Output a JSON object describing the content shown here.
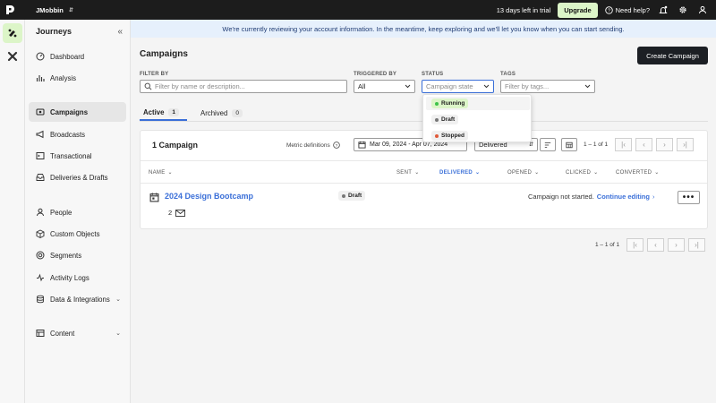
{
  "topbar": {
    "workspace": "JMobbin",
    "trial": "13 days left in trial",
    "upgrade": "Upgrade",
    "help": "Need help?"
  },
  "sidebar": {
    "title": "Journeys",
    "items": [
      {
        "label": "Dashboard",
        "icon": "dashboard-icon"
      },
      {
        "label": "Analysis",
        "icon": "bar-chart-icon"
      },
      {
        "label": "Campaigns",
        "icon": "campaign-icon",
        "active": true
      },
      {
        "label": "Broadcasts",
        "icon": "megaphone-icon"
      },
      {
        "label": "Transactional",
        "icon": "terminal-icon"
      },
      {
        "label": "Deliveries & Drafts",
        "icon": "inbox-icon"
      },
      {
        "label": "People",
        "icon": "person-icon"
      },
      {
        "label": "Custom Objects",
        "icon": "cube-icon"
      },
      {
        "label": "Segments",
        "icon": "segments-icon"
      },
      {
        "label": "Activity Logs",
        "icon": "activity-icon"
      },
      {
        "label": "Data & Integrations",
        "icon": "database-icon",
        "expandable": true
      },
      {
        "label": "Content",
        "icon": "content-icon",
        "expandable": true
      }
    ]
  },
  "banner": "We're currently reviewing your account information. In the meantime, keep exploring and we'll let you know when you can start sending.",
  "page": {
    "title": "Campaigns",
    "create_button": "Create Campaign"
  },
  "filters": {
    "filter_by_label": "FILTER BY",
    "search_placeholder": "Filter by name or description...",
    "triggered_by_label": "TRIGGERED BY",
    "triggered_by_value": "All",
    "status_label": "STATUS",
    "status_placeholder": "Campaign state",
    "tags_label": "TAGS",
    "tags_placeholder": "Filter by tags..."
  },
  "status_options": [
    {
      "label": "Running",
      "color": "#3ec24a",
      "bg": "#dcf5c8"
    },
    {
      "label": "Draft",
      "color": "#777777",
      "bg": "#f0f0f0"
    },
    {
      "label": "Stopped",
      "color": "#e05a3a",
      "bg": "#f0f0f0"
    }
  ],
  "tabs": [
    {
      "label": "Active",
      "count": "1"
    },
    {
      "label": "Archived",
      "count": "0"
    }
  ],
  "card": {
    "count_title": "1 Campaign",
    "metric_definitions": "Metric definitions",
    "date_range": "Mar 09, 2024 - Apr 07, 2024",
    "metric_select": "Delivered",
    "pager": "1 – 1 of 1"
  },
  "columns": [
    "NAME",
    "SENT",
    "DELIVERED",
    "OPENED",
    "CLICKED",
    "CONVERTED"
  ],
  "campaign": {
    "name": "2024 Design Bootcamp",
    "status": "Draft",
    "message_count": "2",
    "status_text": "Campaign not started.",
    "continue_link": "Continue editing"
  },
  "bottom_pager": "1 – 1 of 1",
  "colors": {
    "accent": "#3a6fd8",
    "upgrade_bg": "#dcf5c8",
    "banner_bg": "#e6f0fc"
  }
}
